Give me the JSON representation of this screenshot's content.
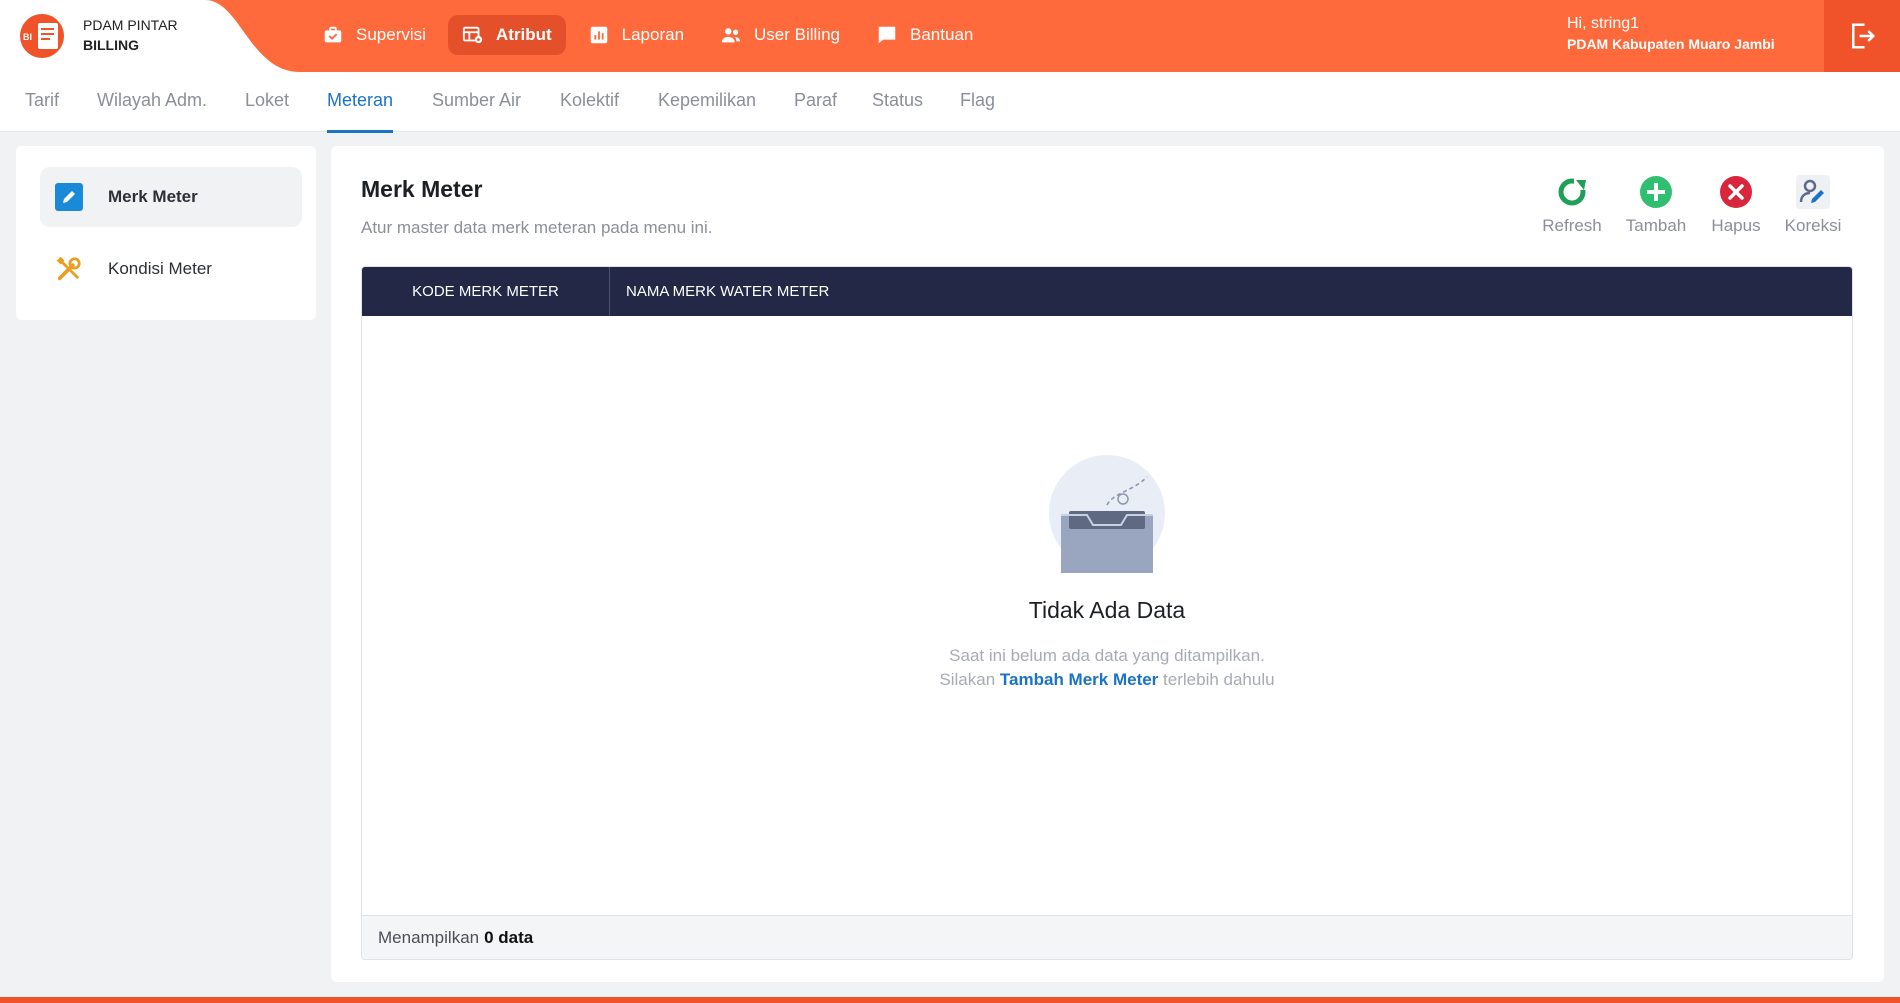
{
  "app": {
    "logo_badge": "BI",
    "line1": "PDAM PINTAR",
    "line2": "BILLING"
  },
  "nav": [
    {
      "label": "Supervisi",
      "icon": "briefcase-check-icon"
    },
    {
      "label": "Atribut",
      "icon": "table-cog-icon",
      "active": true
    },
    {
      "label": "Laporan",
      "icon": "bar-chart-icon"
    },
    {
      "label": "User Billing",
      "icon": "users-icon"
    },
    {
      "label": "Bantuan",
      "icon": "chat-bubble-icon"
    }
  ],
  "user": {
    "greeting": "Hi, string1",
    "org": "PDAM Kabupaten Muaro Jambi"
  },
  "subtabs": [
    "Tarif",
    "Wilayah Adm.",
    "Loket",
    "Meteran",
    "Sumber Air",
    "Kolektif",
    "Kepemilikan",
    "Paraf",
    "Status",
    "Flag"
  ],
  "active_subtab": "Meteran",
  "sidebar": [
    {
      "label": "Merk Meter",
      "icon": "pencil-icon",
      "active": true
    },
    {
      "label": "Kondisi Meter",
      "icon": "tools-icon"
    }
  ],
  "page": {
    "title": "Merk Meter",
    "subtitle": "Atur master data merk meteran pada menu ini."
  },
  "toolbar": [
    {
      "label": "Refresh",
      "icon": "refresh-icon",
      "color": "#1f9e57"
    },
    {
      "label": "Tambah",
      "icon": "plus-circle-icon",
      "color": "#2fbf71"
    },
    {
      "label": "Hapus",
      "icon": "close-circle-icon",
      "color": "#d9263c"
    },
    {
      "label": "Koreksi",
      "icon": "user-edit-icon",
      "color": "#5b6b8c"
    }
  ],
  "table": {
    "columns": [
      "KODE MERK METER",
      "NAMA MERK WATER METER"
    ],
    "rows": []
  },
  "empty": {
    "title": "Tidak Ada Data",
    "line1": "Saat ini belum ada data yang ditampilkan.",
    "line2_prefix": "Silakan",
    "line2_link": "Tambah Merk Meter",
    "line2_suffix": "terlebih dahulu"
  },
  "footer": {
    "prefix": "Menampilkan",
    "count": "0 data"
  },
  "colors": {
    "primary": "#ff6a3d",
    "accent": "#1a73c7",
    "header_dark": "#232846"
  }
}
